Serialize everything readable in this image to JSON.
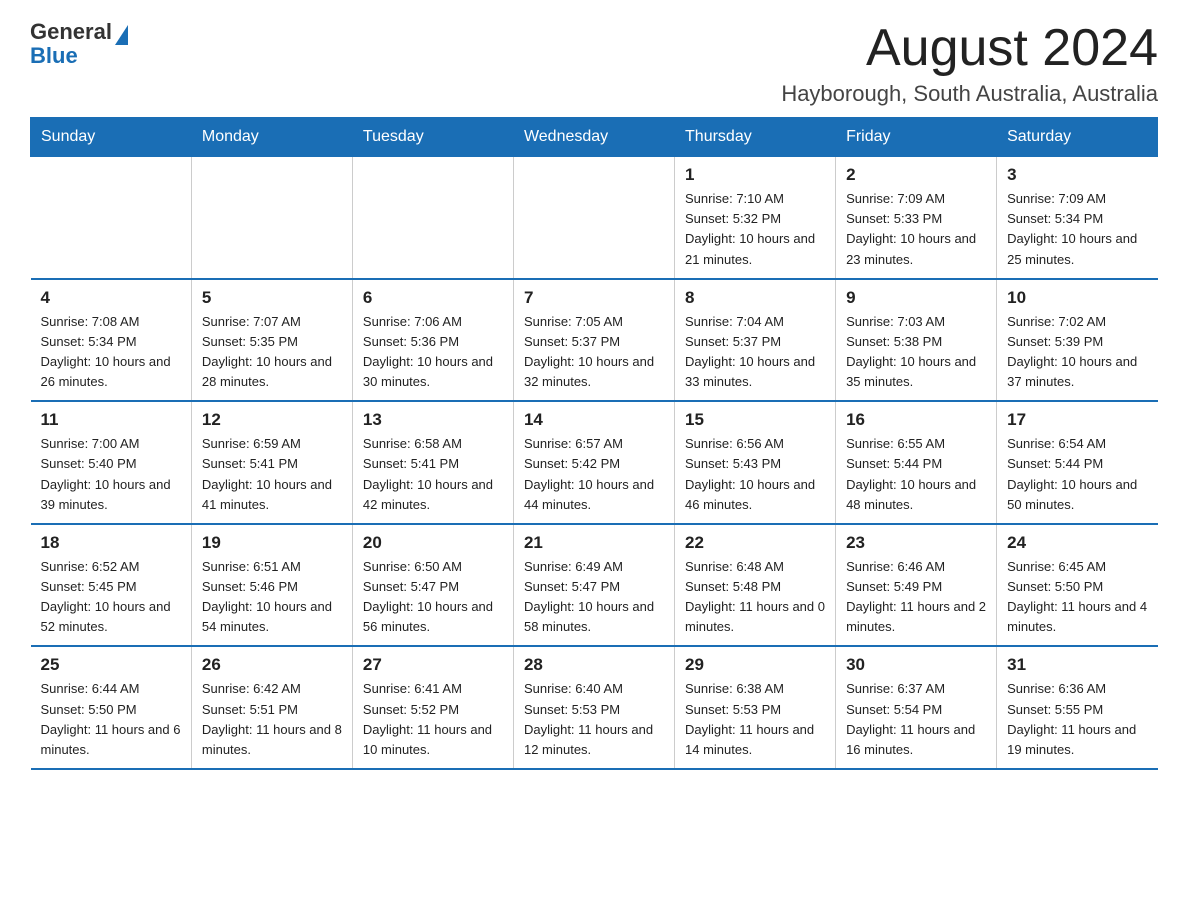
{
  "header": {
    "logo_general": "General",
    "logo_blue": "Blue",
    "month_title": "August 2024",
    "location": "Hayborough, South Australia, Australia"
  },
  "days_of_week": [
    "Sunday",
    "Monday",
    "Tuesday",
    "Wednesday",
    "Thursday",
    "Friday",
    "Saturday"
  ],
  "weeks": [
    {
      "days": [
        {
          "number": "",
          "info": ""
        },
        {
          "number": "",
          "info": ""
        },
        {
          "number": "",
          "info": ""
        },
        {
          "number": "",
          "info": ""
        },
        {
          "number": "1",
          "info": "Sunrise: 7:10 AM\nSunset: 5:32 PM\nDaylight: 10 hours and 21 minutes."
        },
        {
          "number": "2",
          "info": "Sunrise: 7:09 AM\nSunset: 5:33 PM\nDaylight: 10 hours and 23 minutes."
        },
        {
          "number": "3",
          "info": "Sunrise: 7:09 AM\nSunset: 5:34 PM\nDaylight: 10 hours and 25 minutes."
        }
      ]
    },
    {
      "days": [
        {
          "number": "4",
          "info": "Sunrise: 7:08 AM\nSunset: 5:34 PM\nDaylight: 10 hours and 26 minutes."
        },
        {
          "number": "5",
          "info": "Sunrise: 7:07 AM\nSunset: 5:35 PM\nDaylight: 10 hours and 28 minutes."
        },
        {
          "number": "6",
          "info": "Sunrise: 7:06 AM\nSunset: 5:36 PM\nDaylight: 10 hours and 30 minutes."
        },
        {
          "number": "7",
          "info": "Sunrise: 7:05 AM\nSunset: 5:37 PM\nDaylight: 10 hours and 32 minutes."
        },
        {
          "number": "8",
          "info": "Sunrise: 7:04 AM\nSunset: 5:37 PM\nDaylight: 10 hours and 33 minutes."
        },
        {
          "number": "9",
          "info": "Sunrise: 7:03 AM\nSunset: 5:38 PM\nDaylight: 10 hours and 35 minutes."
        },
        {
          "number": "10",
          "info": "Sunrise: 7:02 AM\nSunset: 5:39 PM\nDaylight: 10 hours and 37 minutes."
        }
      ]
    },
    {
      "days": [
        {
          "number": "11",
          "info": "Sunrise: 7:00 AM\nSunset: 5:40 PM\nDaylight: 10 hours and 39 minutes."
        },
        {
          "number": "12",
          "info": "Sunrise: 6:59 AM\nSunset: 5:41 PM\nDaylight: 10 hours and 41 minutes."
        },
        {
          "number": "13",
          "info": "Sunrise: 6:58 AM\nSunset: 5:41 PM\nDaylight: 10 hours and 42 minutes."
        },
        {
          "number": "14",
          "info": "Sunrise: 6:57 AM\nSunset: 5:42 PM\nDaylight: 10 hours and 44 minutes."
        },
        {
          "number": "15",
          "info": "Sunrise: 6:56 AM\nSunset: 5:43 PM\nDaylight: 10 hours and 46 minutes."
        },
        {
          "number": "16",
          "info": "Sunrise: 6:55 AM\nSunset: 5:44 PM\nDaylight: 10 hours and 48 minutes."
        },
        {
          "number": "17",
          "info": "Sunrise: 6:54 AM\nSunset: 5:44 PM\nDaylight: 10 hours and 50 minutes."
        }
      ]
    },
    {
      "days": [
        {
          "number": "18",
          "info": "Sunrise: 6:52 AM\nSunset: 5:45 PM\nDaylight: 10 hours and 52 minutes."
        },
        {
          "number": "19",
          "info": "Sunrise: 6:51 AM\nSunset: 5:46 PM\nDaylight: 10 hours and 54 minutes."
        },
        {
          "number": "20",
          "info": "Sunrise: 6:50 AM\nSunset: 5:47 PM\nDaylight: 10 hours and 56 minutes."
        },
        {
          "number": "21",
          "info": "Sunrise: 6:49 AM\nSunset: 5:47 PM\nDaylight: 10 hours and 58 minutes."
        },
        {
          "number": "22",
          "info": "Sunrise: 6:48 AM\nSunset: 5:48 PM\nDaylight: 11 hours and 0 minutes."
        },
        {
          "number": "23",
          "info": "Sunrise: 6:46 AM\nSunset: 5:49 PM\nDaylight: 11 hours and 2 minutes."
        },
        {
          "number": "24",
          "info": "Sunrise: 6:45 AM\nSunset: 5:50 PM\nDaylight: 11 hours and 4 minutes."
        }
      ]
    },
    {
      "days": [
        {
          "number": "25",
          "info": "Sunrise: 6:44 AM\nSunset: 5:50 PM\nDaylight: 11 hours and 6 minutes."
        },
        {
          "number": "26",
          "info": "Sunrise: 6:42 AM\nSunset: 5:51 PM\nDaylight: 11 hours and 8 minutes."
        },
        {
          "number": "27",
          "info": "Sunrise: 6:41 AM\nSunset: 5:52 PM\nDaylight: 11 hours and 10 minutes."
        },
        {
          "number": "28",
          "info": "Sunrise: 6:40 AM\nSunset: 5:53 PM\nDaylight: 11 hours and 12 minutes."
        },
        {
          "number": "29",
          "info": "Sunrise: 6:38 AM\nSunset: 5:53 PM\nDaylight: 11 hours and 14 minutes."
        },
        {
          "number": "30",
          "info": "Sunrise: 6:37 AM\nSunset: 5:54 PM\nDaylight: 11 hours and 16 minutes."
        },
        {
          "number": "31",
          "info": "Sunrise: 6:36 AM\nSunset: 5:55 PM\nDaylight: 11 hours and 19 minutes."
        }
      ]
    }
  ]
}
